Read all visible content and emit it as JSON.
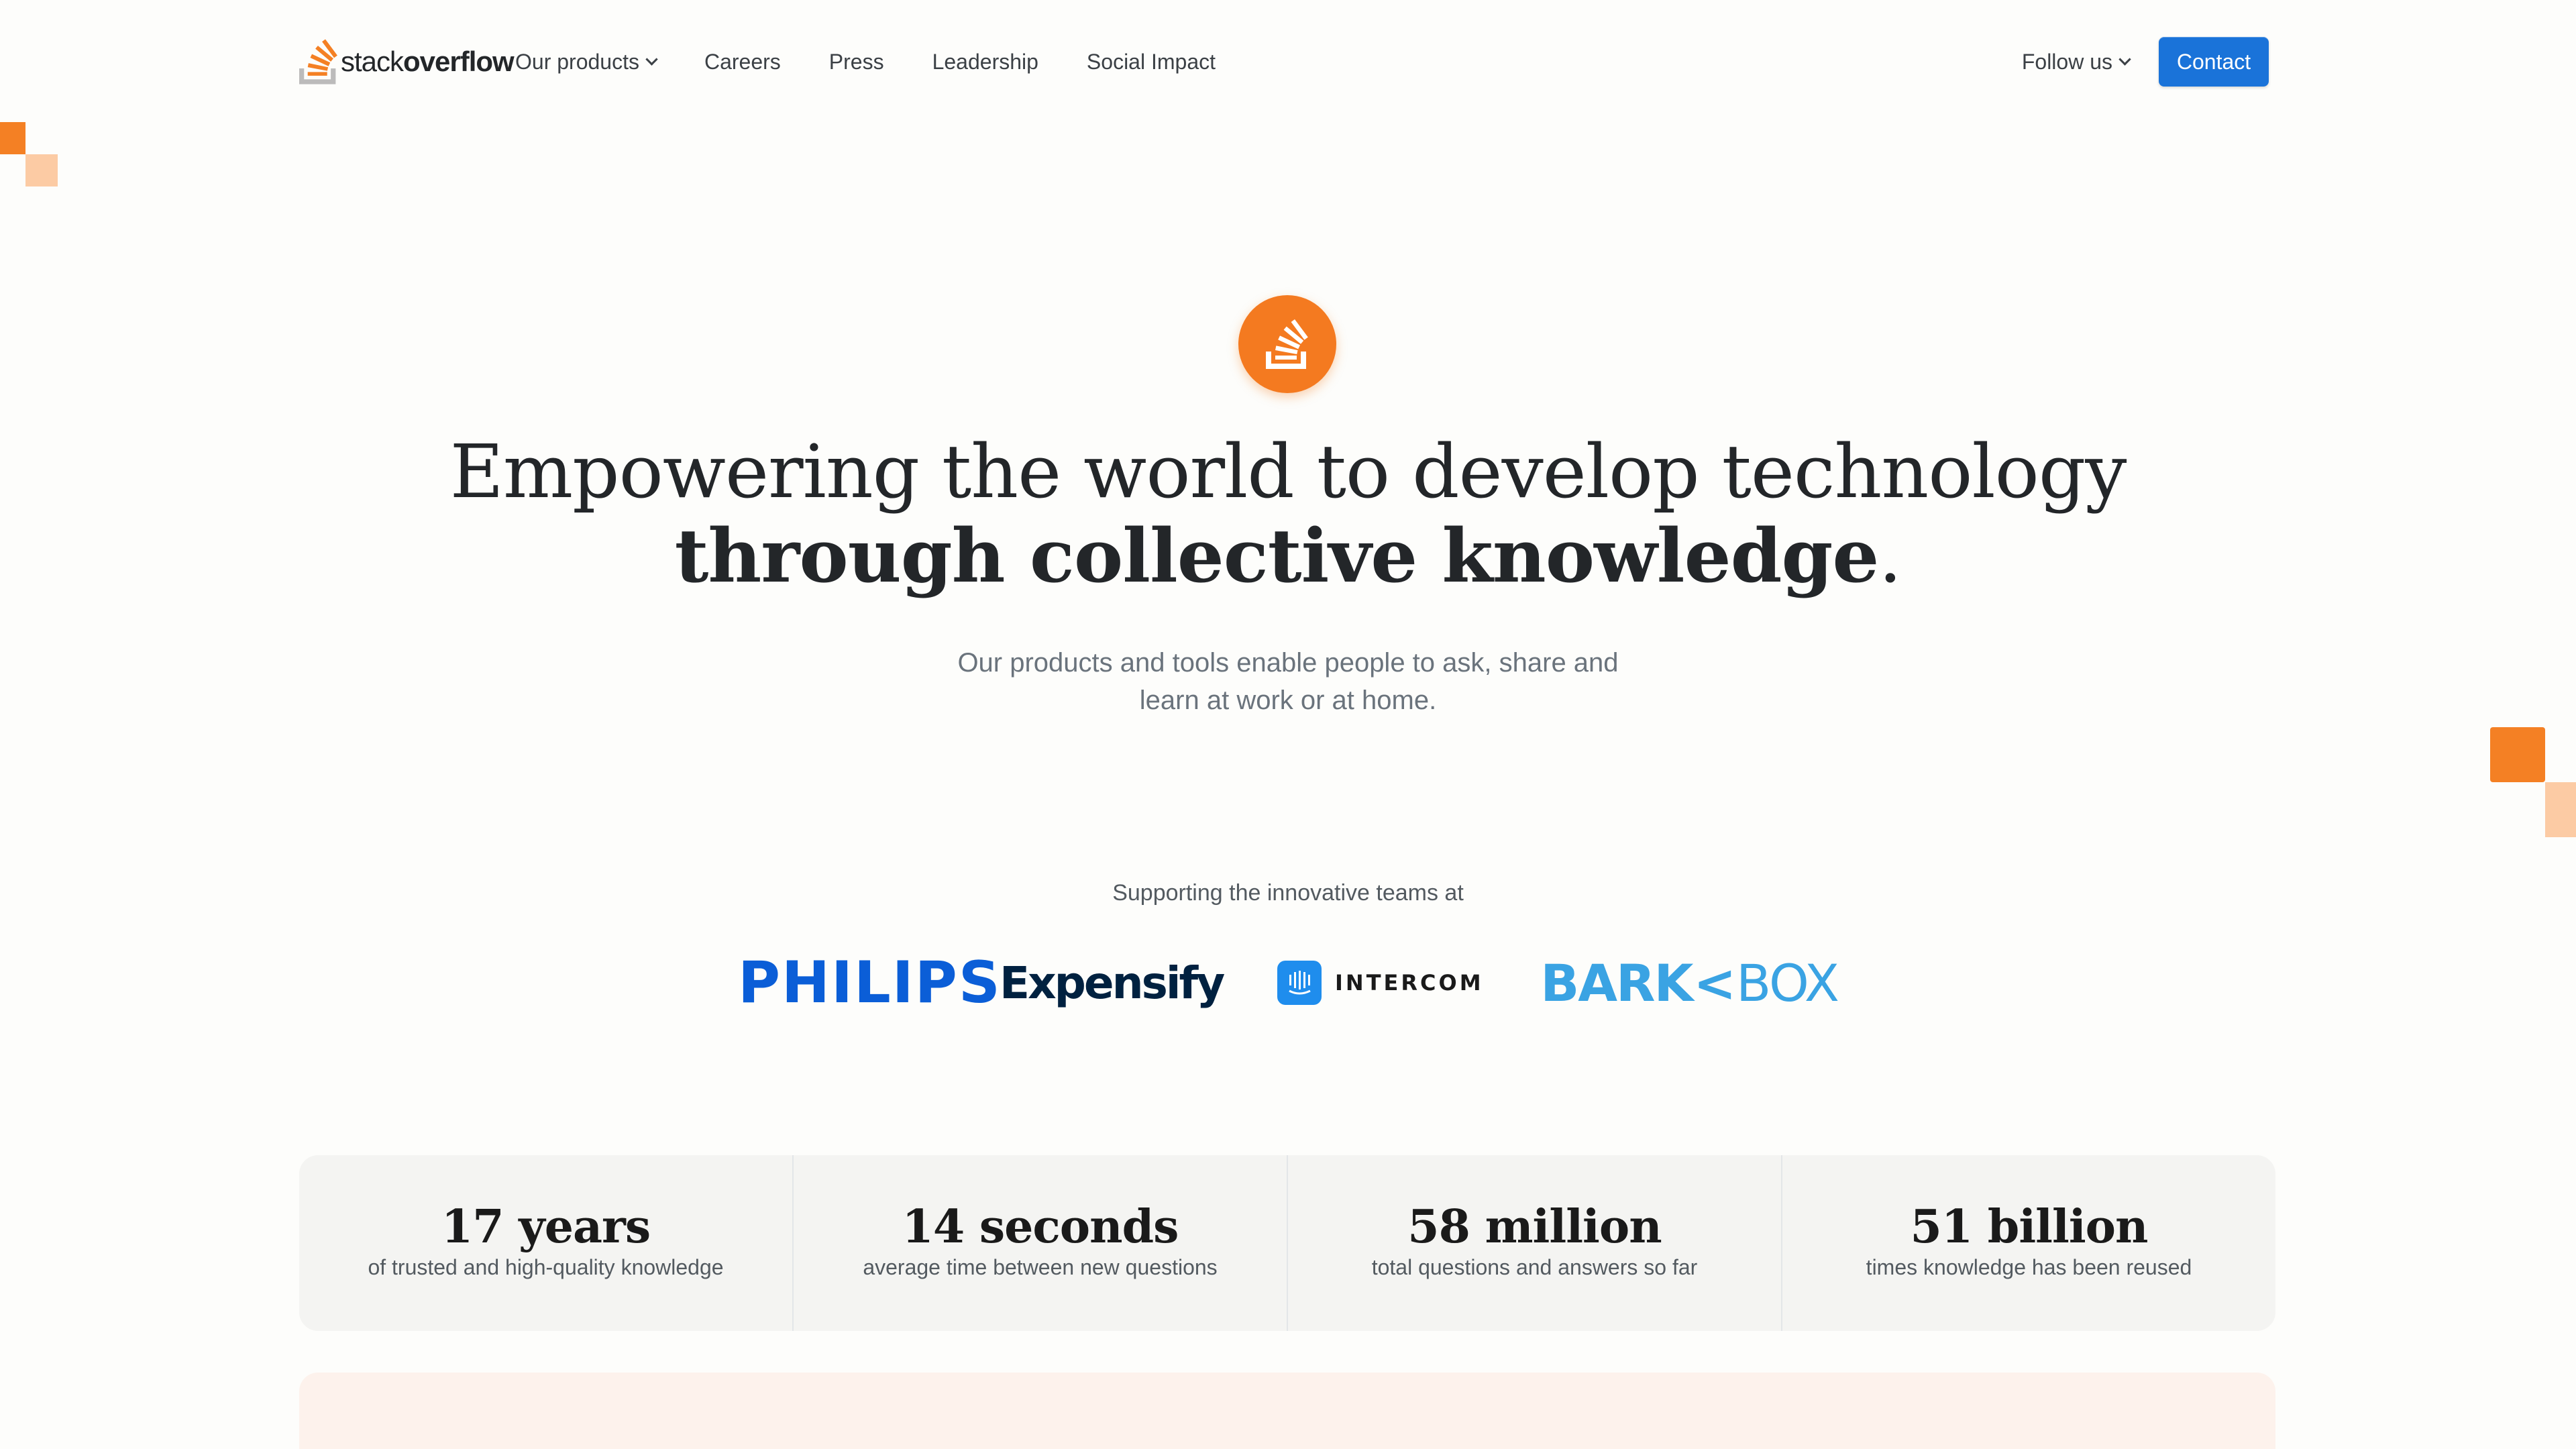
{
  "colors": {
    "brand_orange": "#f48024",
    "brand_orange_light": "#fccba4",
    "contact_blue": "#1a73d9",
    "stats_background": "#f4f4f2",
    "bottom_panel_background": "#fdf2ec"
  },
  "header": {
    "logo": {
      "word1": "stack",
      "word2": "overflow",
      "icon": "stackoverflow-logo-icon"
    },
    "nav": [
      {
        "label": "Our products",
        "has_dropdown": true
      },
      {
        "label": "Careers",
        "has_dropdown": false
      },
      {
        "label": "Press",
        "has_dropdown": false
      },
      {
        "label": "Leadership",
        "has_dropdown": false
      },
      {
        "label": "Social Impact",
        "has_dropdown": false
      }
    ],
    "follow_label": "Follow us",
    "contact_label": "Contact"
  },
  "hero": {
    "icon": "stackoverflow-circle-icon",
    "headline_line1": "Empowering the world to develop technology",
    "headline_line2_bold": "through collective knowledge",
    "headline_line2_end": ".",
    "subtext_line1": "Our products and tools enable people to ask, share and",
    "subtext_line2": "learn at work or at home."
  },
  "support": {
    "label": "Supporting the innovative teams at",
    "brands": [
      {
        "name": "PHILIPS",
        "icon": "philips-logo"
      },
      {
        "name": "Expensify",
        "icon": "expensify-logo"
      },
      {
        "name": "INTERCOM",
        "icon": "intercom-logo"
      },
      {
        "name_part1": "BARK",
        "name_part2": "BOX",
        "icon": "barkbox-logo"
      }
    ]
  },
  "stats": [
    {
      "value": "17 years",
      "label": "of trusted and high-quality knowledge"
    },
    {
      "value": "14 seconds",
      "label": "average time between new questions"
    },
    {
      "value": "58 million",
      "label": "total questions and answers so far"
    },
    {
      "value": "51 billion",
      "label": "times knowledge has been reused"
    }
  ]
}
